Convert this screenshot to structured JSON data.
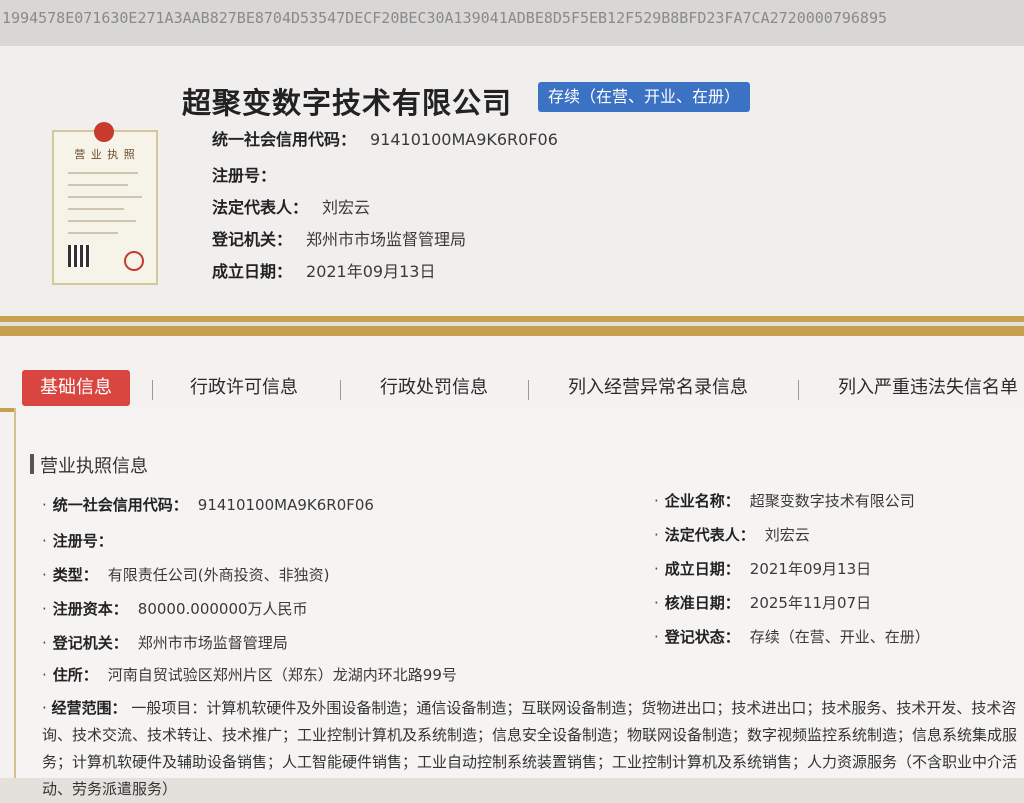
{
  "hash_bar": "1994578E071630E271A3AAB827BE8704D53547DECF20BEC30A139041ADBE8D5F5EB12F529B8BFD23FA7CA2720000796895",
  "header": {
    "company_name": "超聚变数字技术有限公司",
    "status": "存续（在营、开业、在册）",
    "license_thumb_title": "营 业 执 照",
    "rows": [
      {
        "label": "统一社会信用代码：",
        "value": "91410100MA9K6R0F06"
      },
      {
        "label": "注册号：",
        "value": ""
      },
      {
        "label": "法定代表人：",
        "value": "刘宏云"
      },
      {
        "label": "登记机关：",
        "value": "郑州市市场监督管理局"
      },
      {
        "label": "成立日期：",
        "value": "2021年09月13日"
      }
    ]
  },
  "tabs": [
    {
      "label": "基础信息",
      "active": true
    },
    {
      "label": "行政许可信息",
      "active": false
    },
    {
      "label": "行政处罚信息",
      "active": false
    },
    {
      "label": "列入经营异常名录信息",
      "active": false
    },
    {
      "label": "列入严重违法失信名单",
      "active": false
    }
  ],
  "section": {
    "title": "营业执照信息",
    "left": [
      {
        "label": "统一社会信用代码：",
        "value": "91410100MA9K6R0F06"
      },
      {
        "label": "注册号：",
        "value": ""
      },
      {
        "label": "类型：",
        "value": "有限责任公司(外商投资、非独资)"
      },
      {
        "label": "注册资本：",
        "value": "80000.000000万人民币"
      },
      {
        "label": "登记机关：",
        "value": "郑州市市场监督管理局"
      },
      {
        "label": "住所：",
        "value": "河南自贸试验区郑州片区（郑东）龙湖内环北路99号"
      }
    ],
    "right": [
      {
        "label": "企业名称：",
        "value": "超聚变数字技术有限公司"
      },
      {
        "label": "法定代表人：",
        "value": "刘宏云"
      },
      {
        "label": "成立日期：",
        "value": "2021年09月13日"
      },
      {
        "label": "核准日期：",
        "value": "2025年11月07日"
      },
      {
        "label": "登记状态：",
        "value": "存续（在营、开业、在册）"
      }
    ],
    "scope_label": "经营范围：",
    "scope_text": "一般项目：计算机软硬件及外围设备制造；通信设备制造；互联网设备制造；货物进出口；技术进出口；技术服务、技术开发、技术咨询、技术交流、技术转让、技术推广；工业控制计算机及系统制造；信息安全设备制造；物联网设备制造；数字视频监控系统制造；信息系统集成服务；计算机软硬件及辅助设备销售；人工智能硬件销售；工业自动控制系统装置销售；工业控制计算机及系统销售；人力资源服务（不含职业中介活动、劳务派遣服务）"
  },
  "colors": {
    "accent": "#c7a04d",
    "active_tab": "#d9453f",
    "status_pill": "#3b72c4"
  }
}
